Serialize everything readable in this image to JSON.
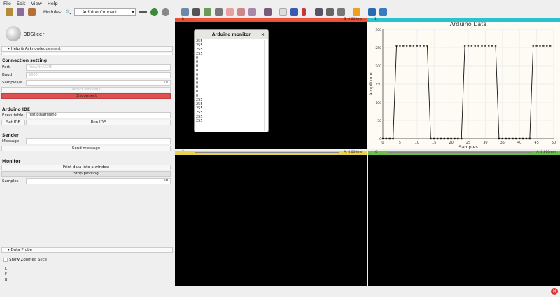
{
  "menu": [
    "File",
    "Edit",
    "View",
    "Help"
  ],
  "toolbar": {
    "modules_label": "Modules:",
    "module_selected": "Arduino Connect"
  },
  "logo": "3DSlicer",
  "help_section": "Help & Acknowledgement",
  "connection": {
    "title": "Connection setting",
    "port_label": "Port:",
    "port_value": "/dev/ttyACM0",
    "baud_label": "Baud",
    "baud_value": "9600",
    "samples_label": "Samples/s",
    "samples_value": "10",
    "detect_button": "Detect device(s)",
    "disconnect_button": "Disconnect",
    "disconnect_color": "#e05050"
  },
  "ide": {
    "title": "Arduino IDE",
    "exec_label": "Executable",
    "exec_value": "/usr/bin/arduino",
    "set_button": "Set IDE",
    "run_button": "Run IDE"
  },
  "sender": {
    "title": "Sender",
    "message_label": "Message",
    "message_value": "",
    "send_button": "Send message"
  },
  "monitor": {
    "title": "Monitor",
    "print_button": "Print data into a window",
    "stop_button": "Stop plotting",
    "samples_label": "Samples",
    "samples_value": "50"
  },
  "data_probe": {
    "title": "Data Probe",
    "show_zoomed": "Show Zoomed Slice",
    "coords": [
      "L",
      "F",
      "B"
    ]
  },
  "views": {
    "red": {
      "label": "R",
      "value": "S: 0.000mm",
      "color": "#e8503a"
    },
    "yellow": {
      "label": "Y",
      "value": "A: 0.000mm",
      "color": "#e8d44c"
    },
    "green": {
      "label": "G",
      "value": "A: 0.000mm",
      "color": "#6cc04a"
    },
    "chart": {
      "label": "1",
      "color": "#27c3cf"
    }
  },
  "monitor_window": {
    "title": "Arduino monitor",
    "close": "×",
    "lines": [
      "255",
      "255",
      "255",
      "255",
      "0",
      "0",
      "0",
      "0",
      "0",
      "0",
      "0",
      "0",
      "0",
      "0",
      "255",
      "255",
      "255",
      "255",
      "255",
      "255"
    ]
  },
  "chart_data": {
    "type": "line",
    "title": "Arduino Data",
    "xlabel": "Samples",
    "ylabel": "Amplitude",
    "xlim": [
      0,
      50
    ],
    "ylim": [
      0,
      300
    ],
    "xticks": [
      0,
      5,
      10,
      15,
      20,
      25,
      30,
      35,
      40,
      45,
      50
    ],
    "yticks": [
      0,
      50,
      100,
      150,
      200,
      250,
      300
    ],
    "x": [
      0,
      1,
      2,
      3,
      4,
      5,
      6,
      7,
      8,
      9,
      10,
      11,
      12,
      13,
      14,
      15,
      16,
      17,
      18,
      19,
      20,
      21,
      22,
      23,
      24,
      25,
      26,
      27,
      28,
      29,
      30,
      31,
      32,
      33,
      34,
      35,
      36,
      37,
      38,
      39,
      40,
      41,
      42,
      43,
      44,
      45,
      46,
      47,
      48,
      49
    ],
    "y": [
      0,
      0,
      0,
      0,
      255,
      255,
      255,
      255,
      255,
      255,
      255,
      255,
      255,
      255,
      0,
      0,
      0,
      0,
      0,
      0,
      0,
      0,
      0,
      0,
      255,
      255,
      255,
      255,
      255,
      255,
      255,
      255,
      255,
      255,
      0,
      0,
      0,
      0,
      0,
      0,
      0,
      0,
      0,
      0,
      255,
      255,
      255,
      255,
      255,
      255
    ]
  }
}
